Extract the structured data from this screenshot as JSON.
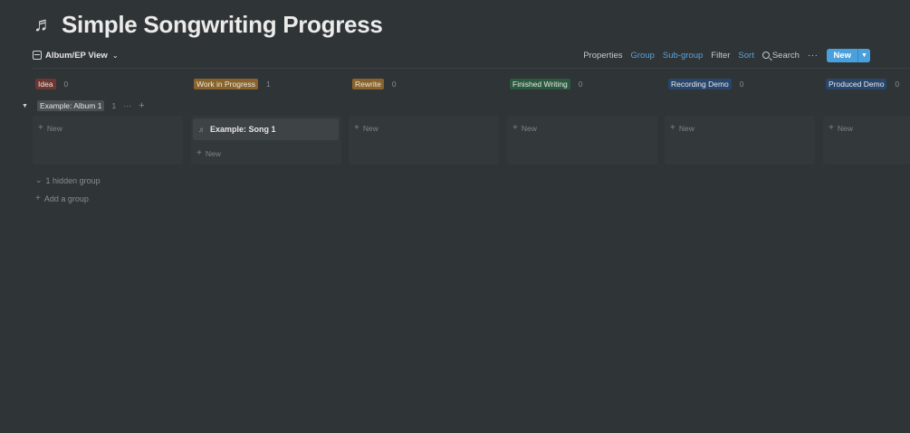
{
  "page": {
    "title": "Simple Songwriting Progress",
    "title_icon": "♬"
  },
  "toolbar": {
    "view_label": "Album/EP View",
    "view_icon": "table-view-icon",
    "properties": "Properties",
    "group": "Group",
    "sub_group": "Sub-group",
    "filter": "Filter",
    "sort": "Sort",
    "search": "Search",
    "more": "···",
    "new_label": "New",
    "accent": "#5aa3d9"
  },
  "columns": [
    {
      "label": "Idea",
      "count": "0",
      "color": "#6e3630"
    },
    {
      "label": "Work in Progress",
      "count": "1",
      "color": "#89632a"
    },
    {
      "label": "Rewrite",
      "count": "0",
      "color": "#89632a"
    },
    {
      "label": "Finished Writing",
      "count": "0",
      "color": "#2b593f"
    },
    {
      "label": "Recording Demo",
      "count": "0",
      "color": "#28456c"
    },
    {
      "label": "Produced Demo",
      "count": "0",
      "color": "#28456c"
    }
  ],
  "group": {
    "label": "Example: Album 1",
    "count": "1",
    "more": "···",
    "add": "+"
  },
  "card": {
    "title": "Example: Song 1",
    "icon": "♬"
  },
  "add_new_label": "New",
  "hidden_group_label": "1 hidden group",
  "add_group_label": "Add a group"
}
